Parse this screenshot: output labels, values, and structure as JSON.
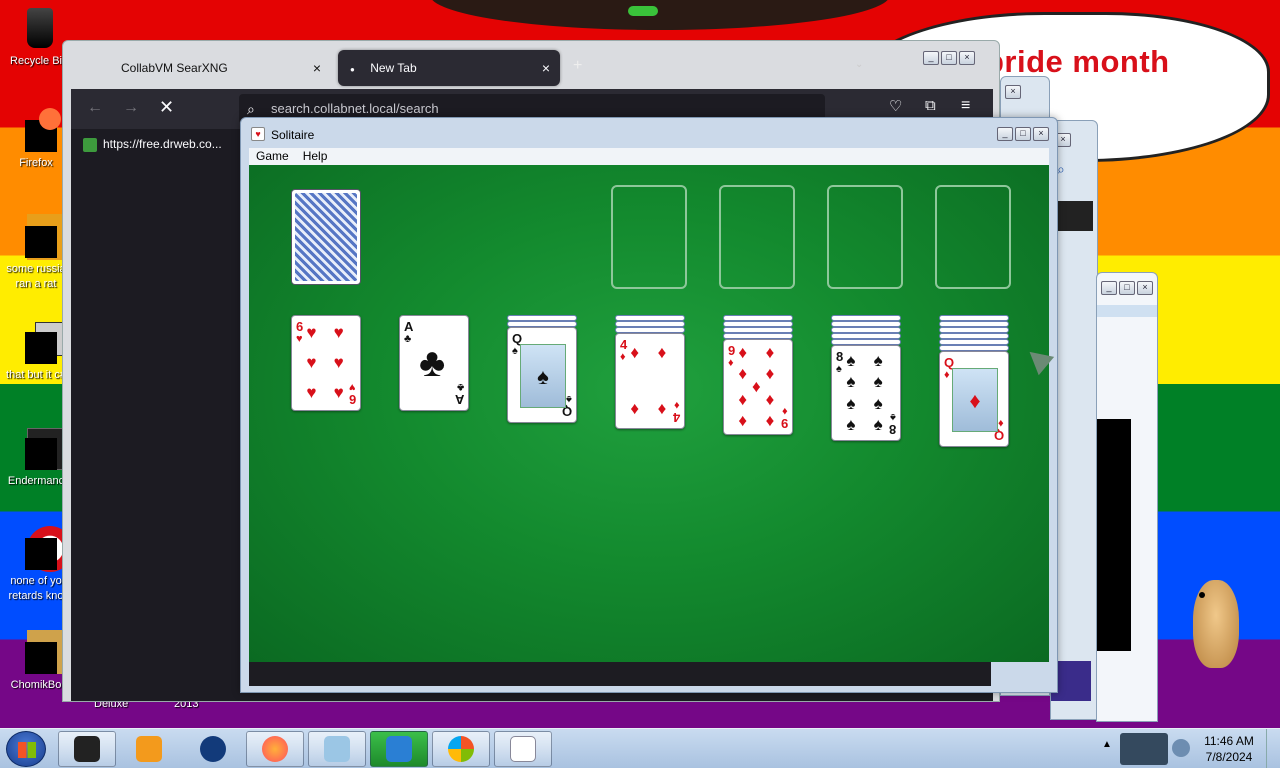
{
  "desktop": {
    "banner_text": "pride month",
    "icons": [
      {
        "label": "Recycle Bi"
      },
      {
        "label": "Firefox"
      },
      {
        "label": "some russia ran a rat"
      },
      {
        "label": "that but it c#"
      },
      {
        "label": "Endermanc"
      },
      {
        "label": "none of yo retards kno"
      },
      {
        "label": "ChomikBo"
      }
    ],
    "bottom_labels": [
      "Deluxe",
      "2013"
    ]
  },
  "firefox": {
    "tabs": [
      {
        "label": "CollabVM SearXNG",
        "close": "×"
      },
      {
        "label": "New Tab",
        "close": "×"
      }
    ],
    "new_tab": "+",
    "url_placeholder": "search.collabnet.local/search",
    "bookmark": "https://free.drweb.co..."
  },
  "solitaire": {
    "title": "Solitaire",
    "menu": [
      "Game",
      "Help"
    ],
    "tableau": [
      {
        "rank": "6",
        "suit": "♥",
        "color": "red",
        "hidden": 0
      },
      {
        "rank": "A",
        "suit": "♣",
        "color": "blk",
        "hidden": 0
      },
      {
        "rank": "Q",
        "suit": "♠",
        "color": "blk",
        "hidden": 2
      },
      {
        "rank": "4",
        "suit": "♦",
        "color": "red",
        "hidden": 3
      },
      {
        "rank": "9",
        "suit": "♦",
        "color": "red",
        "hidden": 4
      },
      {
        "rank": "8",
        "suit": "♠",
        "color": "blk",
        "hidden": 5
      },
      {
        "rank": "Q",
        "suit": "♦",
        "color": "red",
        "hidden": 6
      }
    ]
  },
  "taskbar": {
    "time": "11:46 AM",
    "date": "7/8/2024"
  },
  "colors": {
    "felt": "#138a2e",
    "red_suit": "#d8101a",
    "accent": "#2b2a33"
  }
}
